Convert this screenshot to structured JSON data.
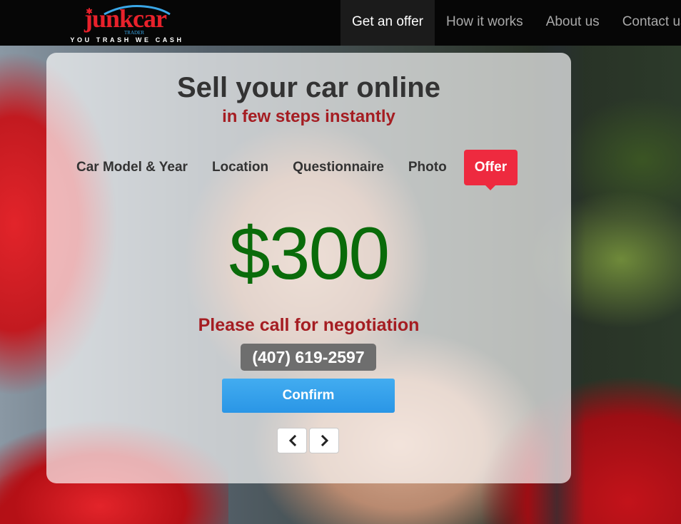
{
  "brand": {
    "logo_text": "junkcar",
    "logo_subtext": "TRADER",
    "tagline": "YOU TRASH WE CASH",
    "colors": {
      "logo_red": "#e8212b",
      "logo_blue": "#3aa6e6"
    }
  },
  "nav": {
    "items": [
      {
        "label": "Get an offer",
        "active": true
      },
      {
        "label": "How it works",
        "active": false
      },
      {
        "label": "About us",
        "active": false
      },
      {
        "label": "Contact us",
        "active": false
      }
    ]
  },
  "hero": {
    "title": "Sell your car online",
    "subtitle": "in few steps instantly"
  },
  "steps": {
    "items": [
      {
        "label": "Car Model & Year",
        "active": false
      },
      {
        "label": "Location",
        "active": false
      },
      {
        "label": "Questionnaire",
        "active": false
      },
      {
        "label": "Photo",
        "active": false
      },
      {
        "label": "Offer",
        "active": true
      }
    ],
    "active_color": "#ee2a3f"
  },
  "offer": {
    "price": "$300",
    "price_color": "#0a6b0a",
    "note": "Please call for negotiation",
    "phone": "(407) 619-2597",
    "confirm_label": "Confirm",
    "confirm_color": "#2a96e6"
  },
  "pager": {
    "prev_icon": "chevron-left-icon",
    "next_icon": "chevron-right-icon"
  }
}
